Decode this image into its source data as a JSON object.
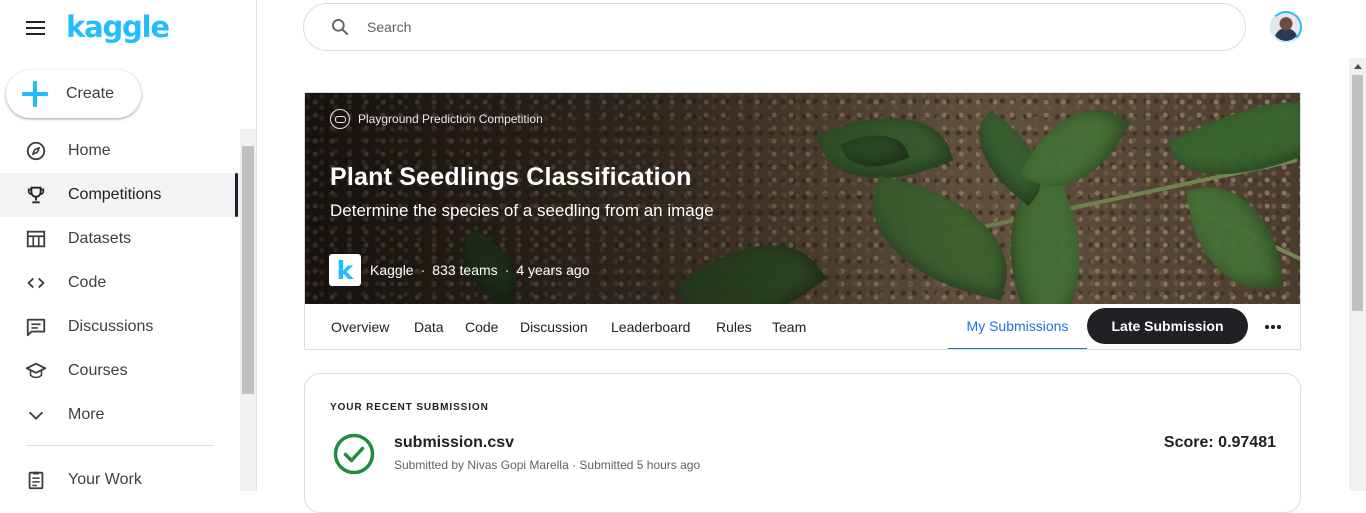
{
  "brand": {
    "logo_text": "kaggle",
    "accent": "#20beff"
  },
  "sidebar": {
    "create_label": "Create",
    "items": [
      {
        "label": "Home",
        "icon": "compass-icon"
      },
      {
        "label": "Competitions",
        "icon": "trophy-icon",
        "active": true
      },
      {
        "label": "Datasets",
        "icon": "table-icon"
      },
      {
        "label": "Code",
        "icon": "code-icon"
      },
      {
        "label": "Discussions",
        "icon": "comments-icon"
      },
      {
        "label": "Courses",
        "icon": "graduation-cap-icon"
      },
      {
        "label": "More",
        "icon": "chevron-down-icon"
      }
    ],
    "your_work_label": "Your Work"
  },
  "search": {
    "placeholder": "Search"
  },
  "competition": {
    "type_label": "Playground Prediction Competition",
    "title": "Plant Seedlings Classification",
    "subtitle": "Determine the species of a seedling from an image",
    "host_logo_letter": "k",
    "host": "Kaggle",
    "teams": "833 teams",
    "age": "4 years ago",
    "tabs": [
      {
        "label": "Overview"
      },
      {
        "label": "Data"
      },
      {
        "label": "Code"
      },
      {
        "label": "Discussion"
      },
      {
        "label": "Leaderboard"
      },
      {
        "label": "Rules"
      },
      {
        "label": "Team"
      },
      {
        "label": "My Submissions",
        "active": true
      }
    ],
    "late_submission_label": "Late Submission"
  },
  "recent_submission": {
    "heading": "YOUR RECENT SUBMISSION",
    "filename": "submission.csv",
    "submitted_by": "Submitted by Nivas Gopi Marella · Submitted 5 hours ago",
    "score": "Score: 0.97481",
    "status_color": "#1e8e3e"
  }
}
